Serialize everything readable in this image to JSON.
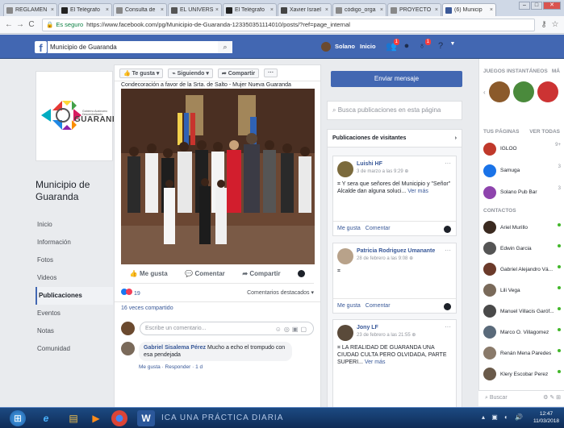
{
  "browser": {
    "tabs": [
      {
        "label": "REGLAMEN",
        "color": "#888"
      },
      {
        "label": "El Telégrafo",
        "color": "#222"
      },
      {
        "label": "Consulta de",
        "color": "#888"
      },
      {
        "label": "EL UNIVERS",
        "color": "#555"
      },
      {
        "label": "El Telégrafo",
        "color": "#222"
      },
      {
        "label": "Xavier Israel",
        "color": "#444"
      },
      {
        "label": "código_orga",
        "color": "#888"
      },
      {
        "label": "PROYECTO",
        "color": "#888"
      },
      {
        "label": "(6) Municip",
        "color": "#3b5998"
      }
    ],
    "url_secure_label": "Es seguro",
    "url": "https://www.facebook.com/pg/Municipio-de-Guaranda-123350351114010/posts/?ref=page_internal"
  },
  "fb": {
    "search_value": "Municipio de Guaranda",
    "user_name": "Solano",
    "home_label": "Inicio",
    "friend_badge": "1",
    "notif_badge": "1"
  },
  "page": {
    "logo_text": "GUARANDA",
    "logo_subtitle": "Gobierno Autónomo Descentralizado",
    "name": "Municipio de Guaranda",
    "nav": [
      "Inicio",
      "Información",
      "Fotos",
      "Videos",
      "Publicaciones",
      "Eventos",
      "Notas",
      "Comunidad"
    ],
    "nav_active_index": 4
  },
  "post": {
    "like_button": "Te gusta",
    "following_button": "Siguiendo",
    "share_button": "Compartir",
    "more_button": "···",
    "caption": "Condecoración a favor de la Srta. de Salto - Mujer Nueva Guaranda",
    "action_like": "Me gusta",
    "action_comment": "Comentar",
    "action_share": "Compartir",
    "reactions_count": "19",
    "comments_filter": "Comentarios destacados ▾",
    "shares": "16 veces compartido",
    "comment_placeholder": "Escribe un comentario...",
    "comment_author": "Gabriel Sisalema Pérez",
    "comment_text": "Mucho a echo el trompudo con esa pendejada",
    "comment_meta": "Me gusta · Responder · 1 d"
  },
  "sidebar": {
    "message_button": "Enviar mensaje",
    "search_placeholder": "Busca publicaciones en esta página",
    "visitor_posts_title": "Publicaciones de visitantes",
    "visitor_posts": [
      {
        "author": "Luishi HF",
        "date": "3 de marzo a las 9:29",
        "text": "Y sera que señores del Municipio y \"Señor\" Alcalde dan alguna soluci...",
        "more": "Ver más",
        "like": "Me gusta",
        "comment": "Comentar"
      },
      {
        "author": "Patricia Rodriguez Umanante",
        "date": "28 de febrero a las 9:08",
        "text": "",
        "more": "",
        "like": "Me gusta",
        "comment": "Comentar"
      },
      {
        "author": "Jony LF",
        "date": "23 de febrero a las 21:55",
        "text": "LA REALIDAD DE GUARANDA UNA CIUDAD CULTA PERO OLVIDADA, PARTE SUPERI...",
        "more": "Ver más",
        "like": "1 Me gusta",
        "comment": ""
      }
    ]
  },
  "chat": {
    "games_title": "JUEGOS INSTANTÁNEOS",
    "games_more": "MÁ",
    "pages_title": "TUS PÁGINAS",
    "see_all": "VER TODAS",
    "pages": [
      {
        "name": "IGLOO",
        "side": "9+"
      },
      {
        "name": "Samuga",
        "side": "3"
      },
      {
        "name": "Solano Pub Bar",
        "side": "3"
      }
    ],
    "contacts_title": "CONTACTOS",
    "contacts": [
      "Ariel Murillo",
      "Edwin Garcia",
      "Gabriel Alejandro Vá...",
      "Lili Vega",
      "Manuel Villacis Garóf...",
      "Marco O. Villagomez",
      "Renán Mena Paredes",
      "Klery Escobar Perez"
    ],
    "search_placeholder": "Buscar"
  },
  "taskbar": {
    "bg_text": "ICA UNA PRÁCTICA DIARIA",
    "time": "12:47",
    "date": "11/03/2018"
  }
}
